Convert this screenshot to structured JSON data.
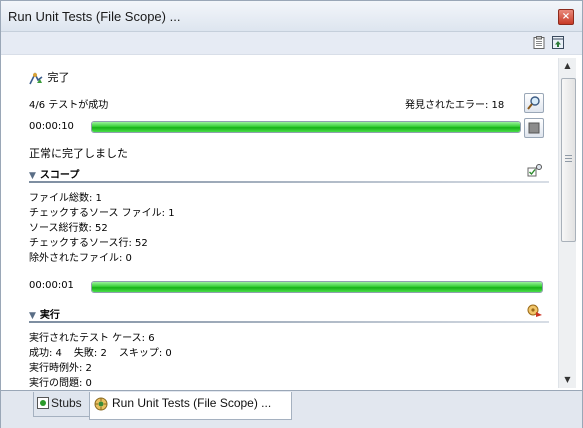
{
  "window": {
    "title": "Run Unit Tests (File Scope) ...",
    "close_glyph": "×"
  },
  "status": {
    "done_label": "完了",
    "summary": "4/6 テストが成功",
    "errors_found": "発見されたエラー: 18",
    "elapsed_1": "00:00:10",
    "progress_1": 1.0,
    "completion": "正常に完了しました"
  },
  "scope": {
    "header": "スコープ",
    "lines": [
      "ファイル総数: 1",
      "チェックするソース ファイル: 1",
      "ソース総行数: 52",
      "チェックするソース行: 52",
      "除外されたファイル: 0"
    ],
    "elapsed_2": "00:00:01",
    "progress_2": 1.0
  },
  "execution": {
    "header": "実行",
    "tests_run": "実行されたテスト ケース: 6",
    "success": "成功: 4",
    "failure": "失敗: 2",
    "skipped": "スキップ: 0",
    "exceptions": "実行時例外: 2",
    "problems": "実行の問題: 0"
  },
  "tabs": [
    {
      "label": "Stubs",
      "icon": "stubs-icon"
    },
    {
      "label": "Run Unit Tests (File Scope) ...",
      "icon": "run-tests-icon"
    }
  ],
  "colors": {
    "progress_green": "#22c022",
    "header_line": "#7d8da0",
    "accent_blue": "#5a6e86"
  }
}
